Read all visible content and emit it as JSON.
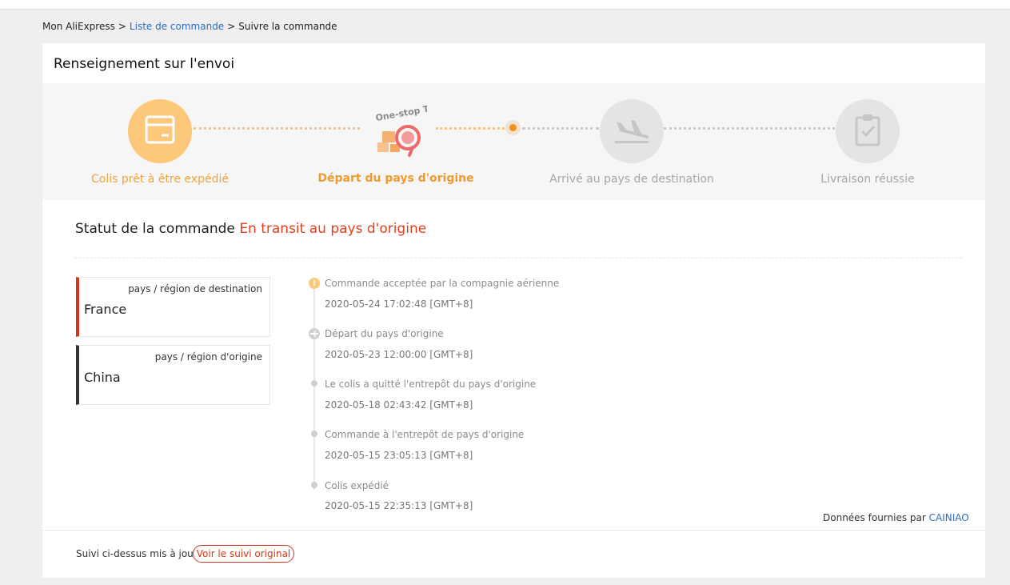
{
  "breadcrumb": {
    "home": "Mon AliExpress",
    "separator": ">",
    "orders": "Liste de commande",
    "current": "Suivre la commande"
  },
  "shipment": {
    "title": "Renseignement sur l'envoi",
    "steps": [
      {
        "label": "Colis prêt à être expédié",
        "state": "done",
        "icon": "package-icon"
      },
      {
        "label": "Départ du pays d'origine",
        "state": "current",
        "icon": "one-stop-tracking-icon",
        "badge_text": "One-stop Tracking"
      },
      {
        "label": "Arrivé au pays de destination",
        "state": "pending",
        "icon": "airplane-landing-icon"
      },
      {
        "label": "Livraison réussie",
        "state": "pending",
        "icon": "clipboard-check-icon"
      }
    ]
  },
  "order_status": {
    "label": "Statut de la commande",
    "value": "En transit au pays d'origine"
  },
  "locations": {
    "destination": {
      "caption": "pays / région de destination",
      "name": "France"
    },
    "origin": {
      "caption": "pays / région d'origine",
      "name": "China"
    }
  },
  "timeline": [
    {
      "text": "Commande acceptée par la compagnie aérienne",
      "time": "2020-05-24 17:02:48 [GMT+8]",
      "icon": "alert-icon"
    },
    {
      "text": "Départ du pays d'origine",
      "time": "2020-05-23 12:00:00 [GMT+8]",
      "icon": "airplane-icon"
    },
    {
      "text": "Le colis a quitté l'entrepôt du pays d'origine",
      "time": "2020-05-18 02:43:42 [GMT+8]",
      "icon": "dot"
    },
    {
      "text": "Commande à l'entrepôt de pays d'origine",
      "time": "2020-05-15 23:05:13 [GMT+8]",
      "icon": "dot"
    },
    {
      "text": "Colis expédié",
      "time": "2020-05-15 22:35:13 [GMT+8]",
      "icon": "dot"
    }
  ],
  "credit": {
    "prefix": "Données fournies par",
    "provider": "CAINIAO"
  },
  "footer": {
    "note": "Suivi ci-dessus mis à jour",
    "button": "Voir le suivi original"
  },
  "colors": {
    "accent_orange": "#f09a2f",
    "status_red": "#e0401f",
    "link_blue": "#2a6ebb"
  }
}
